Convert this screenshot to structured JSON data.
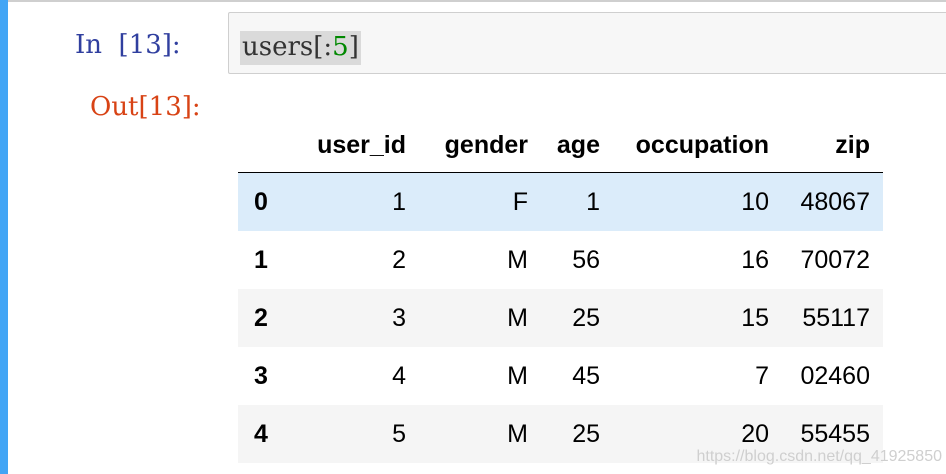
{
  "cell": {
    "in_prompt": "In  [13]:",
    "out_prompt": "Out[13]:",
    "code_text": "users[:",
    "code_number": "5",
    "code_close": "]"
  },
  "table": {
    "columns": [
      "",
      "user_id",
      "gender",
      "age",
      "occupation",
      "zip"
    ],
    "rows": [
      [
        "0",
        "1",
        "F",
        "1",
        "10",
        "48067"
      ],
      [
        "1",
        "2",
        "M",
        "56",
        "16",
        "70072"
      ],
      [
        "2",
        "3",
        "M",
        "25",
        "15",
        "55117"
      ],
      [
        "3",
        "4",
        "M",
        "45",
        "7",
        "02460"
      ],
      [
        "4",
        "5",
        "M",
        "25",
        "20",
        "55455"
      ]
    ],
    "hovered_row": 0
  },
  "watermark": "https://blog.csdn.net/qq_41925850",
  "colors": {
    "in_prompt": "#303f9f",
    "out_prompt": "#d84315",
    "selected_border": "#42a5f5",
    "hover_row": "#dbecfa"
  }
}
